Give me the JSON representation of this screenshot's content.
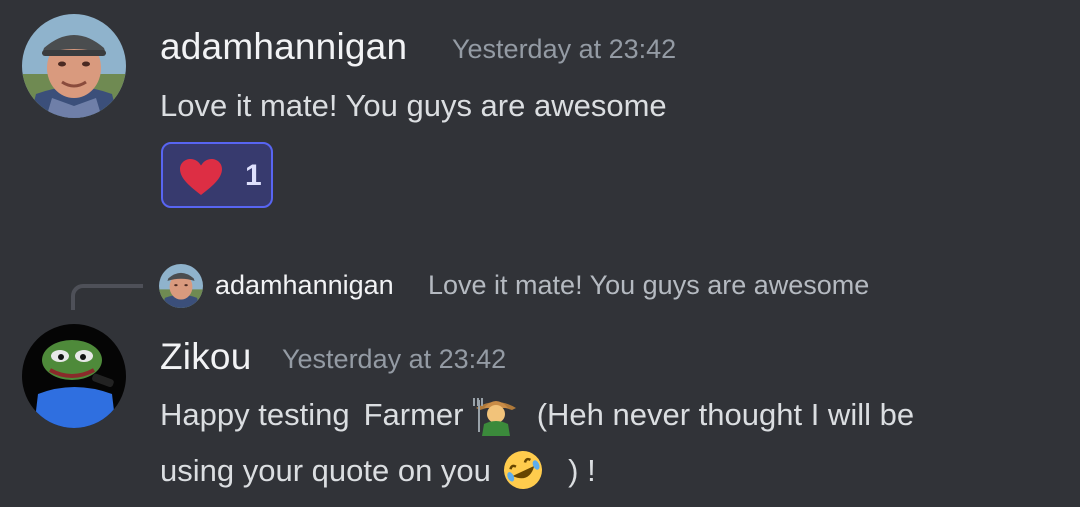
{
  "messages": [
    {
      "author": "adamhannigan",
      "timestamp": "Yesterday at 23:42",
      "text": "Love it mate! You guys are awesome",
      "reactions": [
        {
          "emoji": "heart-emoji",
          "count": "1",
          "selected": true
        }
      ]
    },
    {
      "author": "Zikou",
      "timestamp": "Yesterday at 23:42",
      "reply_to": {
        "author": "adamhannigan",
        "text": "Love it mate! You guys are awesome"
      },
      "line1": {
        "part1": "Happy testing",
        "part2": "Farmer",
        "emoji1": "farmer-emoji",
        "part3": "(Heh never thought I will be"
      },
      "line2": {
        "part1": "using your quote on you",
        "emoji2": "rolling-on-floor-laughing-emoji",
        "part2": ") !"
      }
    }
  ],
  "colors": {
    "background": "#313338",
    "username": "#f2f3f5",
    "timestamp": "#949ba4",
    "text": "#dbdee1",
    "reaction_border": "#5865f2",
    "reaction_bg": "#373a6e",
    "reply_spine": "#4e5058"
  }
}
